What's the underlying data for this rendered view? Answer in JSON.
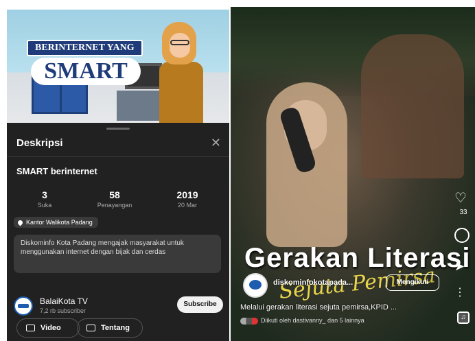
{
  "left": {
    "thumbnail": {
      "line1": "BERINTERNET YANG",
      "line2": "SMART"
    },
    "sheet_title": "Deskripsi",
    "close_icon": "close-icon",
    "video_title": "SMART berinternet",
    "stats": [
      {
        "value": "3",
        "label": "Suka"
      },
      {
        "value": "58",
        "label": "Penayangan"
      },
      {
        "value": "2019",
        "label": "20 Mar"
      }
    ],
    "location": "Kantor Walikota Padang",
    "description": "Diskominfo Kota Padang mengajak masyarakat untuk menggunakan internet dengan bijak dan cerdas",
    "channel": {
      "name": "BalaiKota TV",
      "subscribers": "7,2 rb subscriber",
      "subscribe_label": "Subscribe"
    },
    "tabs": [
      {
        "label": "Video",
        "icon": "play-icon"
      },
      {
        "label": "Tentang",
        "icon": "person-icon"
      }
    ]
  },
  "right": {
    "overlay_title": "Gerakan Literasi",
    "overlay_script": "Sejuta Pemirsa",
    "likes": "33",
    "username": "diskominfokotapada...",
    "follow_label": "Mengikuti",
    "caption": "Melalui gerakan literasi sejuta pemirsa,KPID ...",
    "followed_by": "Diikuti oleh dastivanny_ dan 5 lainnya"
  }
}
